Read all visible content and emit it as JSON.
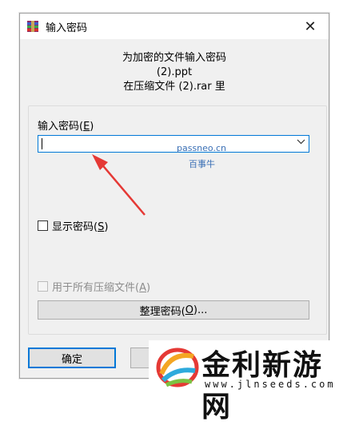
{
  "window": {
    "title": "输入密码"
  },
  "info": {
    "line1": "为加密的文件输入密码",
    "line2": "(2).ppt",
    "line3": "在压缩文件 (2).rar 里"
  },
  "password": {
    "label_text": "输入密码(",
    "label_key": "E",
    "label_end": ")",
    "value": ""
  },
  "watermark": {
    "line1": "passneo.cn",
    "line2": "百事牛"
  },
  "show_password": {
    "text": "显示密码(",
    "key": "S",
    "end": ")",
    "checked": false
  },
  "use_all": {
    "text": "用于所有压缩文件(",
    "key": "A",
    "end": ")",
    "checked": false,
    "disabled": true
  },
  "organize_button": {
    "text": "整理密码(",
    "key": "O",
    "end": ")..."
  },
  "buttons": {
    "ok": "确定",
    "cancel": ""
  },
  "logo": {
    "name": "金利新游网",
    "url": "www.jlnseeds.com"
  },
  "icons": {
    "app": "winrar-icon",
    "close": "close-icon",
    "dropdown": "chevron-down-icon",
    "arrow": "red-arrow-annotation",
    "logo": "swirl-logo-icon"
  },
  "colors": {
    "accent": "#0078d7",
    "arrow": "#e53935",
    "watermark": "#3a6fb5"
  }
}
